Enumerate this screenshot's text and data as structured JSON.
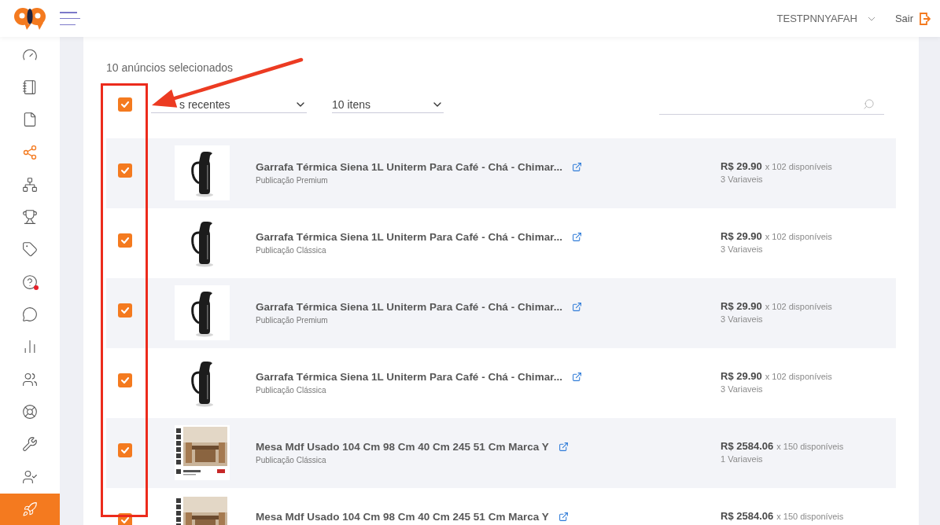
{
  "header": {
    "user": "TESTPNNYAFAH",
    "logout": "Sair"
  },
  "sidebar": {
    "items": [
      {
        "selected": false,
        "highlighted": false,
        "alert": false
      },
      {
        "selected": false,
        "highlighted": false,
        "alert": false
      },
      {
        "selected": false,
        "highlighted": false,
        "alert": false
      },
      {
        "selected": true,
        "highlighted": false,
        "alert": false
      },
      {
        "selected": false,
        "highlighted": false,
        "alert": false
      },
      {
        "selected": false,
        "highlighted": false,
        "alert": false
      },
      {
        "selected": false,
        "highlighted": false,
        "alert": false
      },
      {
        "selected": false,
        "highlighted": false,
        "alert": true
      },
      {
        "selected": false,
        "highlighted": false,
        "alert": false
      },
      {
        "selected": false,
        "highlighted": false,
        "alert": false
      },
      {
        "selected": false,
        "highlighted": false,
        "alert": false
      },
      {
        "selected": false,
        "highlighted": false,
        "alert": false
      },
      {
        "selected": false,
        "highlighted": false,
        "alert": false
      },
      {
        "selected": false,
        "highlighted": false,
        "alert": false
      },
      {
        "selected": false,
        "highlighted": true,
        "alert": false
      }
    ]
  },
  "selection_summary": "10 anúncios selecionados",
  "toolbar": {
    "select_all": {
      "checked": true
    },
    "sort": {
      "value": "s recentes"
    },
    "page_size": {
      "value": "10 itens"
    }
  },
  "listings": [
    {
      "checked": true,
      "kind": "thermos",
      "title": "Garrafa Térmica Siena 1L Uniterm Para Café - Chá - Chimar...",
      "subtitle": "Publicação Premium",
      "price": "R$ 29.90",
      "stock": "x 102 disponíveis",
      "variants": "3 Variaveis"
    },
    {
      "checked": true,
      "kind": "thermos",
      "title": "Garrafa Térmica Siena 1L Uniterm Para Café - Chá - Chimar...",
      "subtitle": "Publicação Clássica",
      "price": "R$ 29.90",
      "stock": "x 102 disponíveis",
      "variants": "3 Variaveis"
    },
    {
      "checked": true,
      "kind": "thermos",
      "title": "Garrafa Térmica Siena 1L Uniterm Para Café - Chá - Chimar...",
      "subtitle": "Publicação Premium",
      "price": "R$ 29.90",
      "stock": "x 102 disponíveis",
      "variants": "3 Variaveis"
    },
    {
      "checked": true,
      "kind": "thermos",
      "title": "Garrafa Térmica Siena 1L Uniterm Para Café - Chá - Chimar...",
      "subtitle": "Publicação Clássica",
      "price": "R$ 29.90",
      "stock": "x 102 disponíveis",
      "variants": "3 Variaveis"
    },
    {
      "checked": true,
      "kind": "table",
      "title": "Mesa Mdf Usado 104 Cm 98 Cm 40 Cm 245 51 Cm Marca Y",
      "subtitle": "Publicação Clássica",
      "price": "R$ 2584.06",
      "stock": "x 150 disponíveis",
      "variants": "1 Variaveis"
    },
    {
      "checked": true,
      "kind": "table",
      "title": "Mesa Mdf Usado 104 Cm 98 Cm 40 Cm 245 51 Cm Marca Y",
      "price": "R$ 2584.06",
      "stock": "x 150 disponíveis"
    }
  ]
}
